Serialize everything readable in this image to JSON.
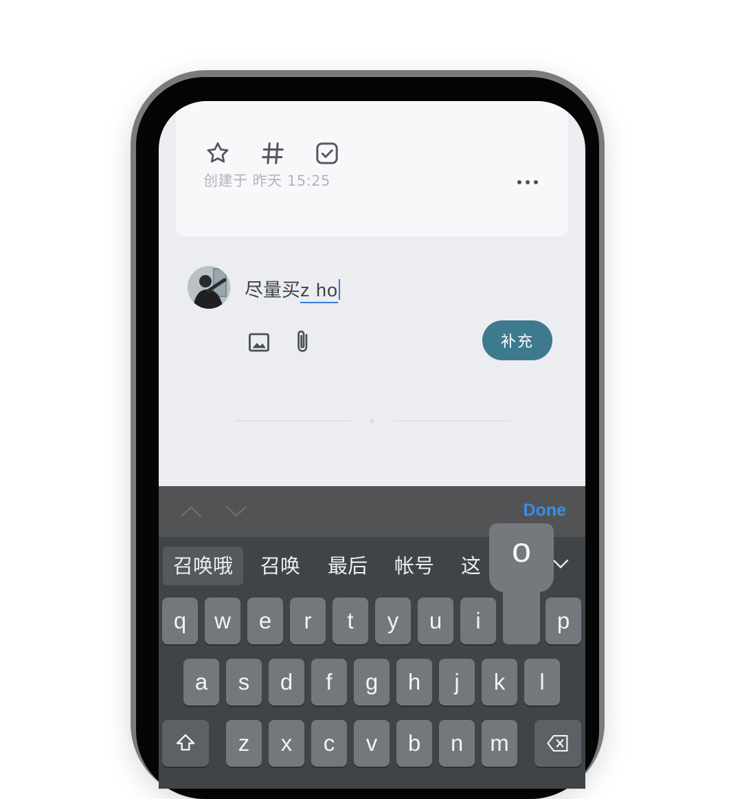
{
  "note": {
    "toolbar_icons": [
      "star-icon",
      "hashtag-icon",
      "checkbox-icon"
    ],
    "created_label": "创建于 昨天 15:25",
    "more_icon": "more-icon"
  },
  "comment": {
    "text_committed": "尽量买",
    "text_composing": "z ho",
    "image_icon": "image-icon",
    "attach_icon": "paperclip-icon",
    "submit_label": "补充"
  },
  "accessory_bar": {
    "prev_icon": "chevron-up-icon",
    "next_icon": "chevron-down-icon",
    "done_label": "Done"
  },
  "keyboard": {
    "candidates": [
      "召唤哦",
      "召唤",
      "最后",
      "帐号",
      "这"
    ],
    "expand_icon": "chevron-down-icon",
    "row1": [
      "q",
      "w",
      "e",
      "r",
      "t",
      "y",
      "u",
      "i",
      "",
      "p"
    ],
    "row2": [
      "a",
      "s",
      "d",
      "f",
      "g",
      "h",
      "j",
      "k",
      "l"
    ],
    "row3": [
      "z",
      "x",
      "c",
      "v",
      "b",
      "n",
      "m"
    ],
    "popup_key": "o",
    "shift_icon": "shift-icon",
    "delete_icon": "backspace-icon"
  },
  "colors": {
    "accent_button": "#3e7a8e",
    "done": "#3b8de6",
    "composing_underline": "#2f7ed8"
  }
}
